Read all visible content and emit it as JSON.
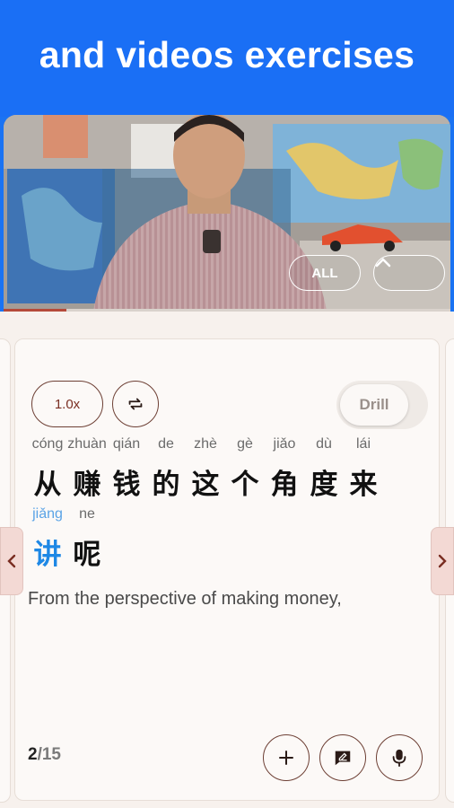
{
  "banner": {
    "title": "and videos exercises"
  },
  "video": {
    "all_label": "ALL",
    "progress": 0.14
  },
  "controls": {
    "speed_label": "1.0x",
    "repeat_icon": "repeat-icon",
    "drill_label": "Drill"
  },
  "sentence": {
    "line1": [
      {
        "pinyin": "cóng",
        "hanzi": "从"
      },
      {
        "pinyin": "zhuàn",
        "hanzi": "赚"
      },
      {
        "pinyin": "qián",
        "hanzi": "钱"
      },
      {
        "pinyin": "de",
        "hanzi": "的"
      },
      {
        "pinyin": "zhè",
        "hanzi": "这"
      },
      {
        "pinyin": "gè",
        "hanzi": "个"
      },
      {
        "pinyin": "jiǎo",
        "hanzi": "角"
      },
      {
        "pinyin": "dù",
        "hanzi": "度"
      },
      {
        "pinyin": "lái",
        "hanzi": "来"
      }
    ],
    "line2": [
      {
        "pinyin": "jiǎng",
        "hanzi": "讲",
        "highlight": true
      },
      {
        "pinyin": "ne",
        "hanzi": "呢"
      }
    ],
    "translation": "From the perspective of making money,"
  },
  "pager": {
    "current": "2",
    "total": "/15"
  },
  "actions": {
    "add_icon": "plus-icon",
    "comment_icon": "comment-icon",
    "mic_icon": "microphone-icon"
  },
  "colors": {
    "banner": "#1a6ff5",
    "accent_dark": "#6d3f34",
    "highlight": "#1e88e5",
    "card_bg": "#fcf9f7"
  }
}
